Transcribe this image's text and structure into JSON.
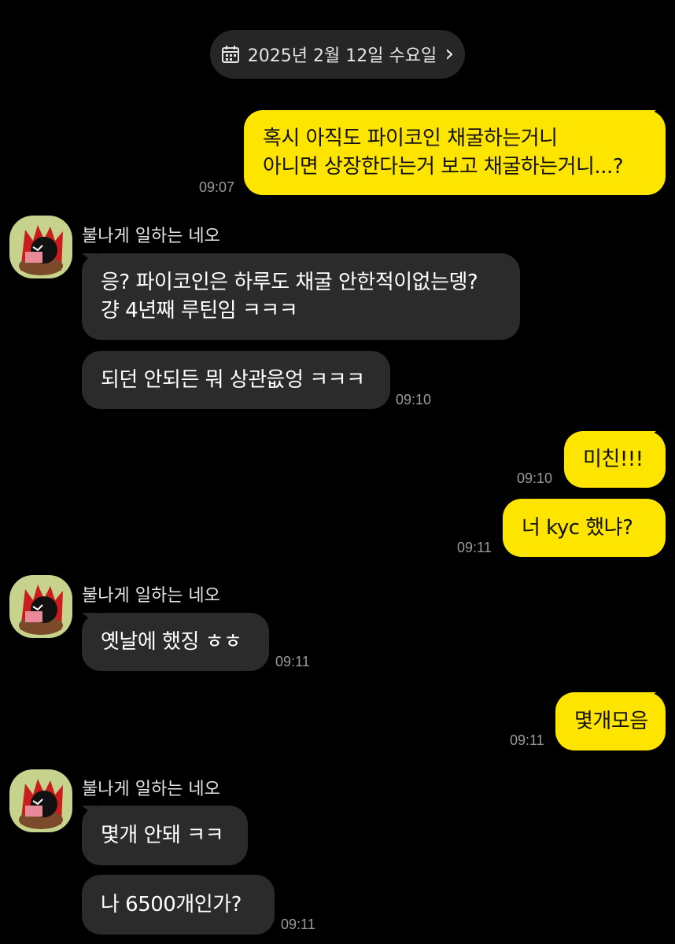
{
  "date_header": {
    "text": "2025년 2월 12일 수요일",
    "chevron": "›"
  },
  "sender_name": "불나게 일하는 네오",
  "messages": {
    "m1": {
      "lines": [
        "혹시 아직도 파이코인 채굴하는거니",
        "아니면 상장한다는거 보고 채굴하는거니...?"
      ],
      "time": "09:07"
    },
    "m2": {
      "lines": [
        "응? 파이코인은 하루도 채굴 안한적이없는뎅?",
        "걍 4년째 루틴임 ㅋㅋㅋ"
      ]
    },
    "m3": {
      "lines": [
        "되던 안되든 뭐 상관읎엉 ㅋㅋㅋ"
      ],
      "time": "09:10"
    },
    "m4": {
      "lines": [
        "미친!!!"
      ],
      "time": "09:10"
    },
    "m5": {
      "lines": [
        "너 kyc 했냐?"
      ],
      "time": "09:11"
    },
    "m6": {
      "lines": [
        "옛날에 했징 ㅎㅎ"
      ],
      "time": "09:11"
    },
    "m7": {
      "lines": [
        "몇개모음"
      ],
      "time": "09:11"
    },
    "m8": {
      "lines": [
        "몇개 안돼 ㅋㅋ"
      ]
    },
    "m9": {
      "lines": [
        "나 6500개인가?"
      ],
      "time": "09:11"
    }
  },
  "colors": {
    "background": "#000000",
    "sent_bubble": "#fee500",
    "received_bubble": "#2b2b2b",
    "avatar_bg": "#c5d38c"
  }
}
